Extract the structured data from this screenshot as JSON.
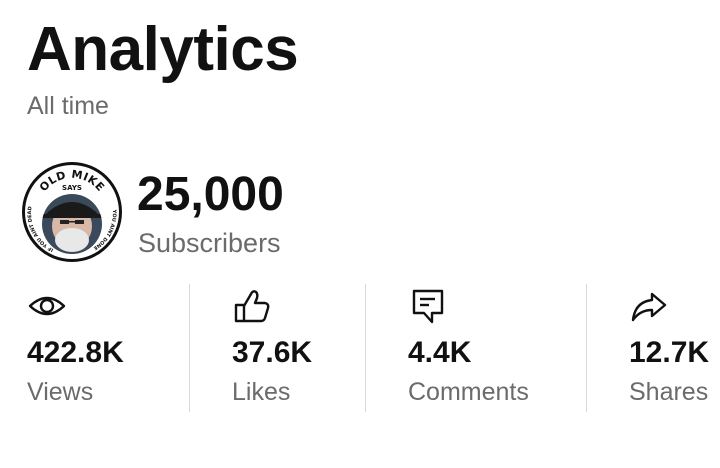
{
  "header": {
    "title": "Analytics",
    "period": "All time"
  },
  "channel": {
    "avatar_text_top": "OLD MIKE",
    "avatar_text_mid": "SAYS",
    "avatar_text_left": "IF YOU AINT DEAD",
    "avatar_text_right": "YOU AINT DONE",
    "subscriber_count": "25,000",
    "subscriber_label": "Subscribers"
  },
  "stats": [
    {
      "icon": "eye-icon",
      "value": "422.8K",
      "label": "Views"
    },
    {
      "icon": "thumbs-up-icon",
      "value": "37.6K",
      "label": "Likes"
    },
    {
      "icon": "comment-icon",
      "value": "4.4K",
      "label": "Comments"
    },
    {
      "icon": "share-icon",
      "value": "12.7K",
      "label": "Shares"
    }
  ],
  "colors": {
    "primary_text": "#111111",
    "secondary_text": "#6b6b6b",
    "divider": "#d9d9d9"
  }
}
